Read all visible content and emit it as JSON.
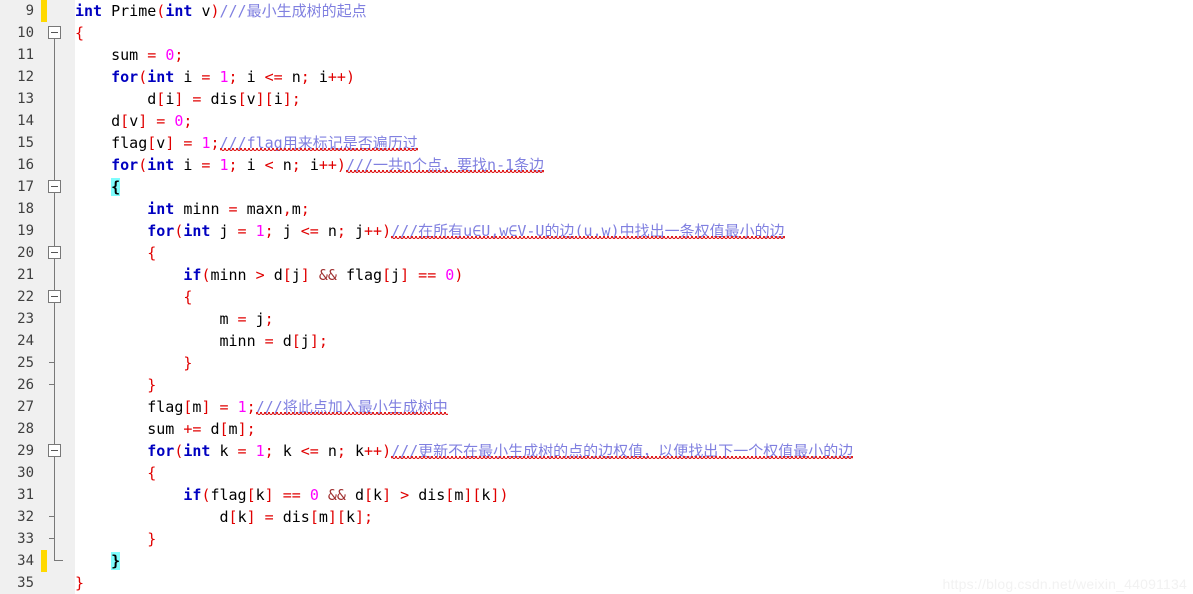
{
  "editor": {
    "first_line_number": 9,
    "last_line_number": 35,
    "line_height_px": 22,
    "colors": {
      "background": "#ffffff",
      "gutter_background": "#f0f0f0",
      "line_number": "#404040",
      "keyword": "#0000c0",
      "number_literal": "#ff00ff",
      "bracket": "#e00000",
      "operator": "#e00000",
      "logical_and": "#a03030",
      "comment": "#8080e0",
      "plain_text": "#000000",
      "matching_brace_highlight": "#7ffdfd",
      "change_bar": "#ffd900",
      "fold_line": "#787878",
      "spellcheck_squiggle": "#e02020",
      "watermark": "#f2f2f2"
    },
    "line_numbers": [
      9,
      10,
      11,
      12,
      13,
      14,
      15,
      16,
      17,
      18,
      19,
      20,
      21,
      22,
      23,
      24,
      25,
      26,
      27,
      28,
      29,
      30,
      31,
      32,
      33,
      34,
      35
    ],
    "change_bar_lines": [
      9,
      34
    ],
    "fold_boxes_lines": [
      10,
      17,
      20,
      22,
      30
    ],
    "fold_tick_lines": [
      25,
      26,
      33,
      34
    ],
    "code_lines": [
      {
        "n": 9,
        "text": "int Prime(int v)///最小生成树的起点"
      },
      {
        "n": 10,
        "text": "{"
      },
      {
        "n": 11,
        "text": "    sum = 0;"
      },
      {
        "n": 12,
        "text": "    for(int i = 1; i <= n; i++)"
      },
      {
        "n": 13,
        "text": "        d[i] = dis[v][i];"
      },
      {
        "n": 14,
        "text": "    d[v] = 0;"
      },
      {
        "n": 15,
        "text": "    flag[v] = 1;///flag用来标记是否遍历过"
      },
      {
        "n": 16,
        "text": "    for(int i = 1; i < n; i++)///一共n个点，要找n-1条边"
      },
      {
        "n": 17,
        "text": "    {"
      },
      {
        "n": 18,
        "text": "        int minn = maxn,m;"
      },
      {
        "n": 19,
        "text": "        for(int j = 1; j <= n; j++)///在所有u∈U,w∈V-U的边(u,w)中找出一条权值最小的边"
      },
      {
        "n": 20,
        "text": "        {"
      },
      {
        "n": 21,
        "text": "            if(minn > d[j] && flag[j] == 0)"
      },
      {
        "n": 22,
        "text": "            {"
      },
      {
        "n": 23,
        "text": "                m = j;"
      },
      {
        "n": 24,
        "text": "                minn = d[j];"
      },
      {
        "n": 25,
        "text": "            }"
      },
      {
        "n": 26,
        "text": "        }"
      },
      {
        "n": 27,
        "text": "        flag[m] = 1;///将此点加入最小生成树中"
      },
      {
        "n": 28,
        "text": "        sum += d[m];"
      },
      {
        "n": 29,
        "text": "        for(int k = 1; k <= n; k++)///更新不在最小生成树的点的边权值，以便找出下一个权值最小的边"
      },
      {
        "n": 30,
        "text": "        {"
      },
      {
        "n": 31,
        "text": "            if(flag[k] == 0 && d[k] > dis[m][k])"
      },
      {
        "n": 32,
        "text": "                d[k] = dis[m][k];"
      },
      {
        "n": 33,
        "text": "        }"
      },
      {
        "n": 34,
        "text": "    }"
      },
      {
        "n": 35,
        "text": "}"
      }
    ],
    "comments": {
      "line9": "///最小生成树的起点",
      "line15": "///flag用来标记是否遍历过",
      "line16": "///一共n个点，要找n-1条边",
      "line19": "///在所有u∈U,w∈V-U的边(u,w)中找出一条权值最小的边",
      "line27": "///将此点加入最小生成树中",
      "line29": "///更新不在最小生成树的点的边权值，以便找出下一个权值最小的边"
    },
    "tokens": {
      "kw_int": "int",
      "kw_for": "for",
      "kw_if": "if",
      "fn_name": "Prime",
      "var_sum": "sum",
      "var_d": "d",
      "var_dis": "dis",
      "var_flag": "flag",
      "var_minn": "minn",
      "var_maxn": "maxn",
      "var_m": "m",
      "var_n": "n",
      "var_v": "v",
      "var_i": "i",
      "var_j": "j",
      "var_k": "k"
    }
  },
  "watermark": {
    "text": "https://blog.csdn.net/weixin_44091134"
  }
}
